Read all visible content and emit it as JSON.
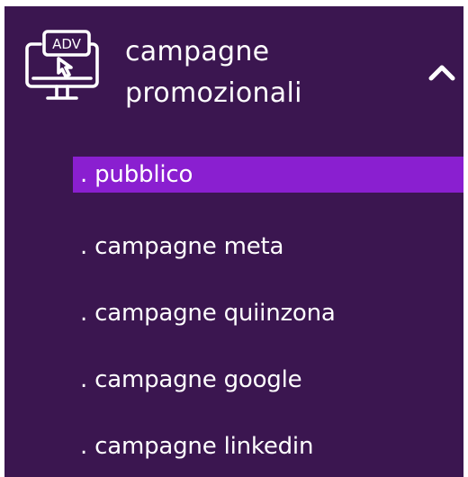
{
  "menu": {
    "header": {
      "label_line1": "campagne",
      "label_line2": "promozionali",
      "icon": "adv-monitor-icon",
      "icon_text": "ADV",
      "chevron_icon": "chevron-up-icon",
      "expanded": true
    },
    "items": [
      {
        "label": ". pubblico",
        "active": true
      },
      {
        "label": ". campagne meta",
        "active": false
      },
      {
        "label": ". campagne quiinzona",
        "active": false
      },
      {
        "label": ". campagne google",
        "active": false
      },
      {
        "label": ". campagne linkedin",
        "active": false
      }
    ]
  },
  "colors": {
    "background": "#3b1650",
    "active_item": "#8a1fd0",
    "text": "#ffffff"
  }
}
